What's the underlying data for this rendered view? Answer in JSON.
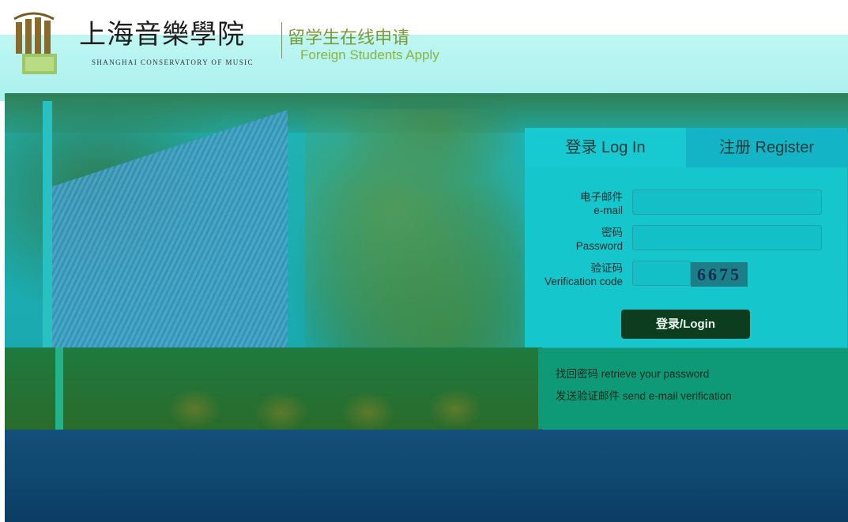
{
  "header": {
    "school_name_cn": "上海音樂學院",
    "school_name_en": "SHANGHAI CONSERVATORY OF MUSIC",
    "apply_title_cn": "留学生在线申请",
    "apply_title_en": "Foreign Students Apply"
  },
  "tabs": {
    "login": "登录 Log In",
    "register": "注册 Register"
  },
  "form": {
    "email": {
      "label_cn": "电子邮件",
      "label_en": "e-mail",
      "value": ""
    },
    "password": {
      "label_cn": "密码",
      "label_en": "Password",
      "value": ""
    },
    "verification": {
      "label_cn": "验证码",
      "label_en": "Verification code",
      "value": "",
      "captcha": "6675"
    },
    "login_button": "登录/Login"
  },
  "links": {
    "retrieve_password": "找回密码 retrieve your password",
    "send_verification": "发送验证邮件 send e-mail verification"
  },
  "colors": {
    "header_band": "#a9f1ef",
    "login_panel": "#15c6cc",
    "login_button": "#0b3d1e",
    "info_panel": "#0e9a76"
  }
}
